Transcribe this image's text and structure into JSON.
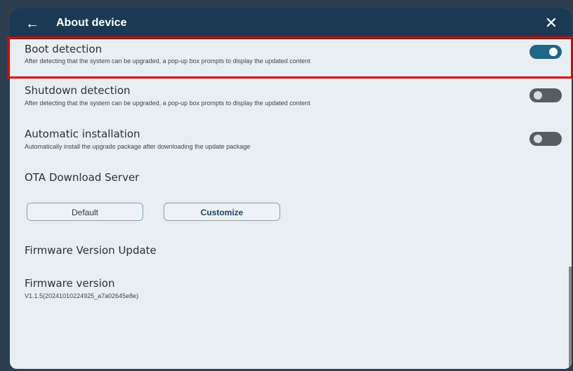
{
  "header": {
    "back_icon": "arrow-left-icon",
    "title": "About device",
    "close_icon": "close-icon"
  },
  "settings": [
    {
      "label": "Boot detection",
      "description": "After detecting that the system can be upgraded, a pop-up box prompts to display the updated content",
      "enabled": true
    },
    {
      "label": "Shutdown detection",
      "description": "After detecting that the system can be upgraded, a pop-up box prompts to display the updated content",
      "enabled": false
    },
    {
      "label": "Automatic installation",
      "description": "Automatically install the upgrade package after downloading the update package",
      "enabled": false
    }
  ],
  "ota": {
    "title": "OTA Download Server",
    "default_label": "Default",
    "customize_label": "Customize"
  },
  "firmware": {
    "update_title": "Firmware Version Update",
    "version_title": "Firmware version",
    "version_value": "V1.1.5(20241010224925_a7a02645e8e)"
  },
  "colors": {
    "header": "#193a52",
    "toggle_on": "#1f6585",
    "toggle_off": "#555c62",
    "highlight": "#e00000"
  }
}
